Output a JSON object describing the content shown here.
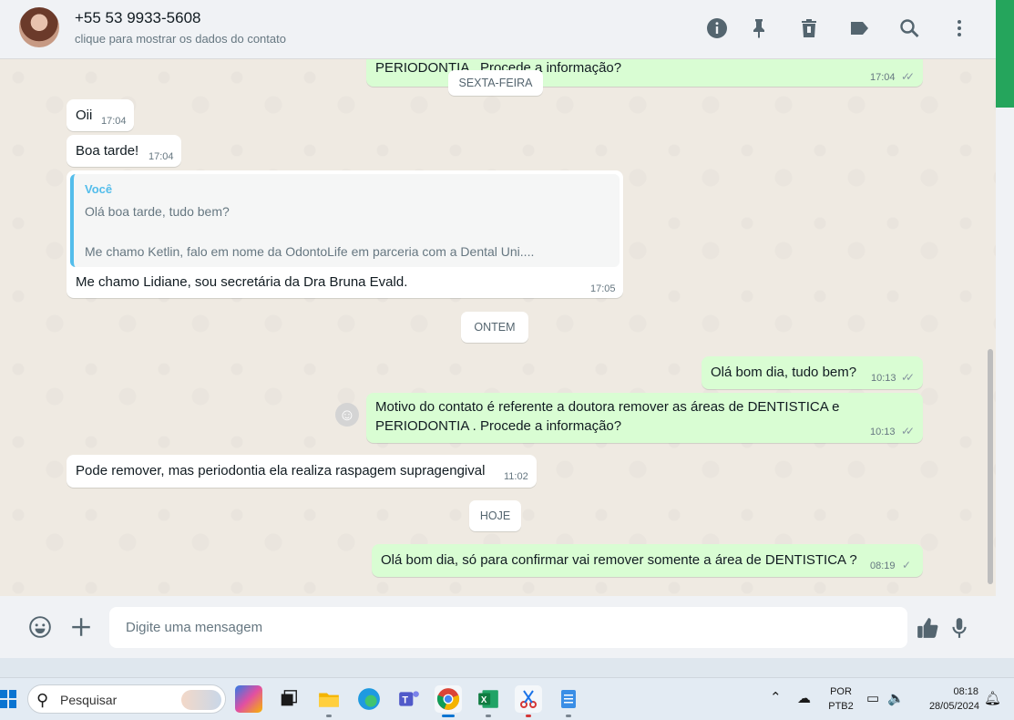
{
  "header": {
    "contact_name": "+55 53 9933-5608",
    "contact_subtitle": "clique para mostrar os dados do contato",
    "icons": [
      "info-icon",
      "pin-icon",
      "delete-icon",
      "label-icon",
      "search-icon",
      "more-vertical-icon"
    ]
  },
  "messages": {
    "m0": {
      "text": "PERIODONTIA . Procede a informação?",
      "time": "17:04",
      "ticks": "✓✓"
    },
    "chip_friday": "SEXTA-FEIRA",
    "m1": {
      "text": "Oii",
      "time": "17:04"
    },
    "m2": {
      "text": "Boa tarde!",
      "time": "17:04"
    },
    "m3": {
      "quote_author": "Você",
      "quote_line1": "Olá boa tarde, tudo bem?",
      "quote_line2": "Me chamo Ketlin, falo em nome da OdontoLife em parceria com a Dental Uni....",
      "text": "Me chamo Lidiane, sou secretária da Dra Bruna Evald.",
      "time": "17:05"
    },
    "chip_yesterday": "ONTEM",
    "m4": {
      "text": "Olá bom dia, tudo bem?",
      "time": "10:13",
      "ticks": "✓✓"
    },
    "m5": {
      "line1": "Motivo do contato é referente a doutora remover as áreas de DENTISTICA e",
      "line2": "PERIODONTIA . Procede a informação?",
      "time": "10:13",
      "ticks": "✓✓"
    },
    "m6": {
      "text": "Pode remover, mas periodontia ela realiza raspagem supragengival",
      "time": "11:02"
    },
    "chip_today": "HOJE",
    "m7": {
      "text": "Olá bom dia, só para confirmar vai remover somente a área de DENTISTICA ?",
      "time": "08:19",
      "ticks": "✓"
    }
  },
  "composer": {
    "placeholder": "Digite uma mensagem",
    "icons": [
      "emoji-icon",
      "plus-icon",
      "thumbs-up-icon",
      "microphone-icon"
    ]
  },
  "taskbar": {
    "search_placeholder": "Pesquisar",
    "lang_line1": "POR",
    "lang_line2": "PTB2",
    "clock_time": "08:18",
    "clock_date": "28/05/2024",
    "apps": [
      "copilot",
      "task-view",
      "file-explorer",
      "edge",
      "teams",
      "chrome",
      "excel",
      "snipping-tool",
      "notepad"
    ]
  }
}
